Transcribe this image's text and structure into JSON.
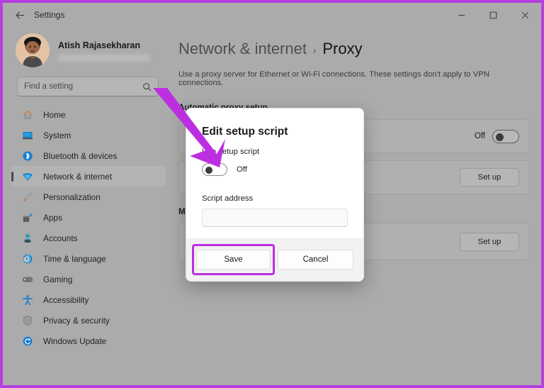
{
  "window": {
    "titlebar_label": "Settings",
    "back_icon": "back-arrow-icon",
    "minimize_label": "Minimize",
    "maximize_label": "Maximize",
    "close_label": "Close",
    "frame_accent_color": "#b43fe0"
  },
  "sidebar": {
    "profile": {
      "name": "Atish Rajasekharan",
      "email_redacted": true
    },
    "search": {
      "placeholder": "Find a setting",
      "value": "",
      "icon": "search-icon"
    },
    "items": [
      {
        "label": "Home",
        "icon": "home-icon",
        "selected": false
      },
      {
        "label": "System",
        "icon": "system-icon",
        "selected": false
      },
      {
        "label": "Bluetooth & devices",
        "icon": "bluetooth-icon",
        "selected": false
      },
      {
        "label": "Network & internet",
        "icon": "wifi-icon",
        "selected": true
      },
      {
        "label": "Personalization",
        "icon": "paintbrush-icon",
        "selected": false
      },
      {
        "label": "Apps",
        "icon": "apps-icon",
        "selected": false
      },
      {
        "label": "Accounts",
        "icon": "accounts-icon",
        "selected": false
      },
      {
        "label": "Time & language",
        "icon": "clock-globe-icon",
        "selected": false
      },
      {
        "label": "Gaming",
        "icon": "gamepad-icon",
        "selected": false
      },
      {
        "label": "Accessibility",
        "icon": "accessibility-icon",
        "selected": false
      },
      {
        "label": "Privacy & security",
        "icon": "shield-icon",
        "selected": false
      },
      {
        "label": "Windows Update",
        "icon": "update-icon",
        "selected": false
      }
    ]
  },
  "main": {
    "breadcrumb": {
      "parent": "Network & internet",
      "separator": "›",
      "current": "Proxy"
    },
    "description": "Use a proxy server for Ethernet or Wi-Fi connections. These settings don't apply to VPN connections.",
    "sections": [
      {
        "title": "Automatic proxy setup"
      },
      {
        "title": "M"
      }
    ],
    "cards": [
      {
        "toggle_state_label": "Off",
        "toggle_on": false,
        "action_label": ""
      },
      {
        "toggle_state_label": "",
        "toggle_on": false,
        "action_label": "Set up"
      },
      {
        "toggle_state_label": "",
        "toggle_on": false,
        "action_label": "Set up"
      }
    ]
  },
  "dialog": {
    "title": "Edit setup script",
    "toggle_label": "Use setup script",
    "toggle_state_label": "Off",
    "toggle_on": false,
    "field_label": "Script address",
    "field_value": "",
    "field_placeholder": "",
    "save_label": "Save",
    "cancel_label": "Cancel"
  },
  "annotations": {
    "arrow_color": "#bc2fe0",
    "highlight_color": "#bc2fe0",
    "arrow_target": "use-setup-script-toggle",
    "highlight_target": "save-button"
  }
}
